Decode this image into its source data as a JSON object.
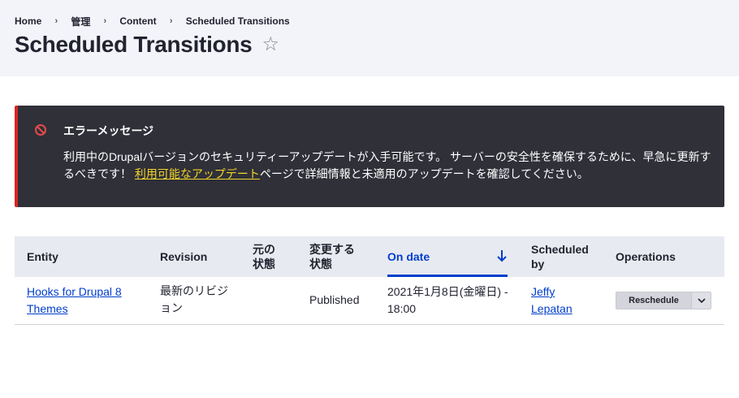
{
  "breadcrumb": [
    {
      "label": "Home"
    },
    {
      "label": "管理"
    },
    {
      "label": "Content"
    },
    {
      "label": "Scheduled Transitions"
    }
  ],
  "page": {
    "title": "Scheduled Transitions"
  },
  "message": {
    "title": "エラーメッセージ",
    "body_before": "利用中のDrupalバージョンのセキュリティーアップデートが入手可能です。 サーバーの安全性を確保するために、早急に更新するべきです！ ",
    "link": "利用可能なアップデート",
    "body_after": "ページで詳細情報と未適用のアップデートを確認してください。",
    "accent_color": "#dc2323"
  },
  "table": {
    "headers": {
      "entity": "Entity",
      "revision": "Revision",
      "from_state": "元の状態",
      "to_state": "変更する状態",
      "on_date": "On date",
      "scheduled_by": "Scheduled by",
      "operations": "Operations"
    },
    "rows": [
      {
        "entity": "Hooks for Drupal 8 Themes",
        "revision": "最新のリビジョン",
        "from_state": "",
        "to_state": "Published",
        "on_date": "2021年1月8日(金曜日) - 18:00",
        "scheduled_by": "Jeffy Lepatan",
        "operation": "Reschedule"
      }
    ]
  },
  "colors": {
    "link": "#003ecc",
    "header_bg": "#f3f4f9",
    "message_bg": "#2f3038"
  }
}
